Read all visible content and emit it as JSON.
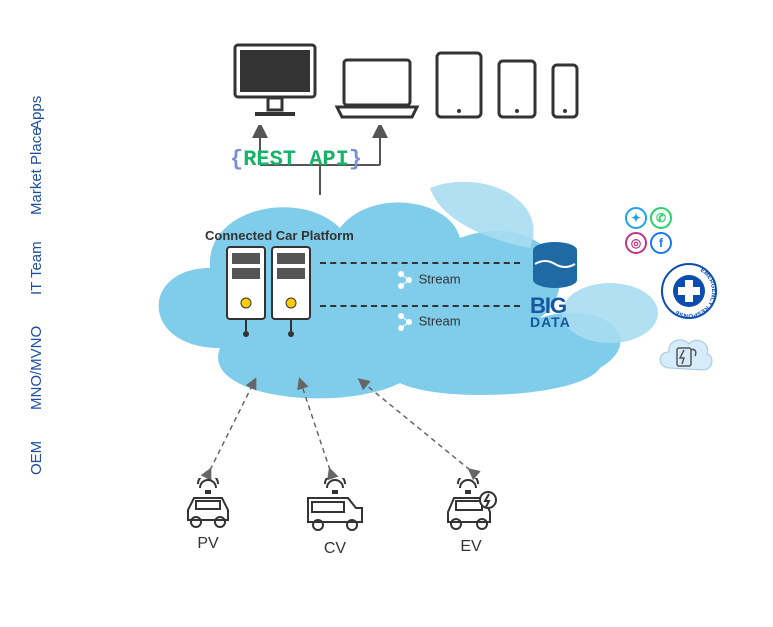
{
  "side": {
    "apps": "Apps",
    "marketplace": "Market Place",
    "it": "IT Team",
    "mno": "MNO/MVNO",
    "oem": "OEM"
  },
  "api_label": "REST API",
  "platform_label": "Connected Car Platform",
  "stream1": "Stream",
  "stream2": "Stream",
  "bigdata": {
    "line1": "BIG",
    "line2": "DATA"
  },
  "cars": {
    "pv": "PV",
    "cv": "CV",
    "ev": "EV"
  },
  "emergency_text": "EMERGENCY RESPONSE",
  "icons": {
    "desktop": "desktop-icon",
    "laptop": "laptop-icon",
    "tablet": "tablet-icon",
    "tablet2": "tablet-icon",
    "phone": "phone-icon",
    "twitter": "twitter-icon",
    "whatsapp": "whatsapp-icon",
    "instagram": "instagram-icon",
    "facebook": "facebook-icon",
    "charging": "charging-station-icon"
  }
}
